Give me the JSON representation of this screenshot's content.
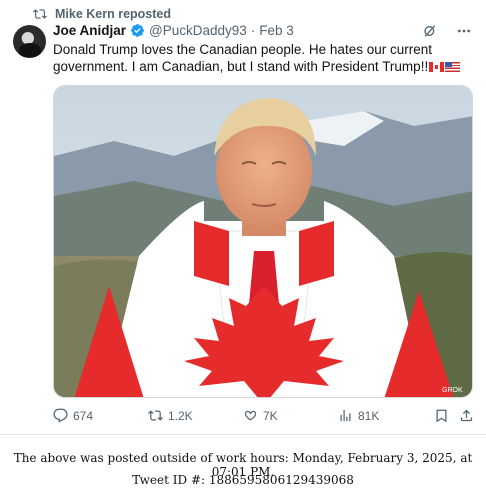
{
  "repost_label": "Mike Kern reposted",
  "tweet": {
    "author_name": "Joe Anidjar",
    "handle": "@PuckDaddy93",
    "separator": "·",
    "date": "Feb 3",
    "text": "Donald Trump loves the Canadian people. He hates our current government. I am Canadian, but I stand with President Trump!!",
    "media_watermark": "GROK"
  },
  "metrics": {
    "replies": "674",
    "reposts": "1.2K",
    "likes": "7K",
    "views": "81K"
  },
  "footer": {
    "line1": "The above was posted outside of work hours: Monday, February 3, 2025, at 07:01 PM.",
    "line2": "Tweet ID #: 1886595806129439068"
  },
  "colors": {
    "text": "#0f1419",
    "muted": "#536471",
    "verified": "#1d9bf0",
    "flag_red": "#e52b2b"
  }
}
